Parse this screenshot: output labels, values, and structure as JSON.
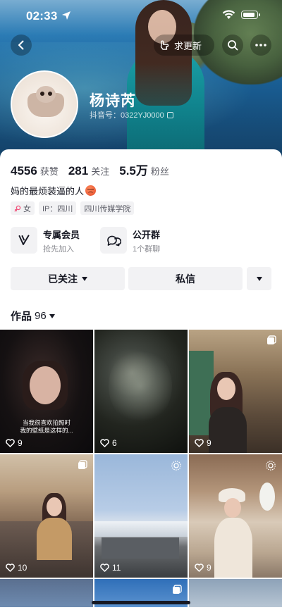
{
  "status_bar": {
    "time": "02:33"
  },
  "header": {
    "update_label": "求更新",
    "username": "杨诗芮",
    "douyin_id": "抖音号：0322YJ0000"
  },
  "stats": [
    {
      "value": "4556",
      "label": "获赞"
    },
    {
      "value": "281",
      "label": "关注"
    },
    {
      "value": "5.5万",
      "label": "粉丝"
    }
  ],
  "bio": "妈的最烦装逼的人",
  "tags": {
    "gender": "女",
    "ip": "IP：四川",
    "school": "四川传媒学院"
  },
  "features": {
    "vip": {
      "title": "专属会员",
      "subtitle": "抢先加入"
    },
    "group": {
      "title": "公开群",
      "subtitle": "1个群聊"
    }
  },
  "actions": {
    "follow": "已关注",
    "message": "私信"
  },
  "works": {
    "label": "作品",
    "count": "96"
  },
  "grid": [
    {
      "likes": "9",
      "caption_line1": "当我很喜欢拍照时",
      "caption_line2": "我的壁纸是这样的..."
    },
    {
      "likes": "6"
    },
    {
      "likes": "9"
    },
    {
      "likes": "10"
    },
    {
      "likes": "11"
    },
    {
      "likes": "9"
    }
  ],
  "colors": {
    "accent_text": "#161823",
    "secondary_text": "#5b5c66",
    "chip_bg": "#f2f2f4",
    "card_bg": "#ffffff"
  },
  "icons": {
    "back": "chevron-left-icon",
    "update": "pointing-hand-icon",
    "search": "search-icon",
    "more": "more-dots-icon",
    "vip": "v-badge-icon",
    "group": "chat-bubbles-icon",
    "gender": "female-icon",
    "likes": "heart-outline-icon",
    "pinned": "stack-icon",
    "live": "ring-icon"
  }
}
